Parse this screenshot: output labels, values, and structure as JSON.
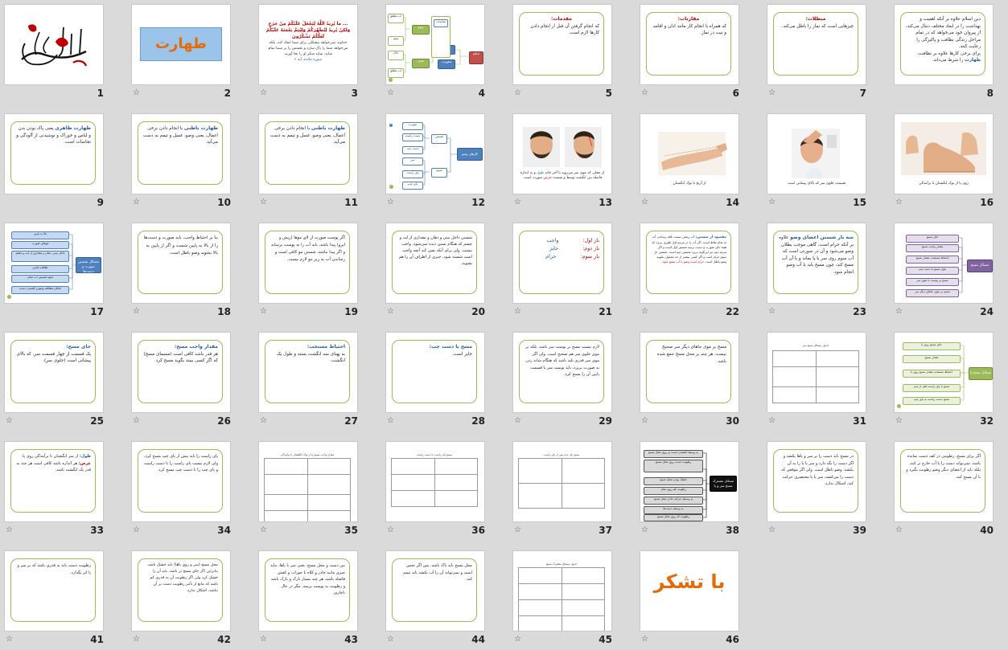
{
  "slides": [
    {
      "num": "1"
    },
    {
      "num": "2",
      "title": "طهارت"
    },
    {
      "num": "3",
      "quote": "... ما یُرِیدُ اللَّهُ لِیَجْعَلَ عَلَیْکُمْ مِنْ حَرَجٍ وَلکِنْ یُرِیدُ لِیُطَهِّرَکُمْ وَلِیُتِمَّ نِعْمَتَهُ عَلَیْکُمْ لَعَلَّکُمْ تَشْکُرُونَ",
      "translation": "خداوند نمی‌خواهد مشکلی برای شما ایجاد کند، بلکه می‌خواهد شما را پاک سازد و نعمتش را بر شما تمام نماید، شاید شکر او را بجا آورید.",
      "source": "سوره مائده، آیه ۶"
    },
    {
      "num": "4",
      "items": [
        "وضو",
        "غسل",
        "تیمم",
        "آب مطلق",
        "خاک",
        "نجاسات",
        "مطهرات",
        "طهارت",
        "احکام"
      ]
    },
    {
      "num": "5",
      "title": "مقدمات:",
      "body": "که انجام گرفتن آن قبل از انجام دادن کارها لازم است."
    },
    {
      "num": "6",
      "title": "مقارنات:",
      "body": "که همراه با انجام کار مانند اذان و اقامه و نیت در نماز."
    },
    {
      "num": "7",
      "title": "مبطلات:",
      "body": "چیزهایی است که نماز را باطل می‌کند."
    },
    {
      "num": "8",
      "body": "دین اسلام علاوه بر آنکه اهمیت و بهداشت را در ابعاد مختلف دنبال می‌کند، از پیروان خود می‌خواهد که در تمام مراحل زندگی نظافت و پاکیزگی را رعایت کنند.",
      "tail_pre": "برای برخی کارها علاوه بر نظافت،",
      "tail_em": "طهارت",
      "tail_post": "را شرط می‌داند."
    },
    {
      "num": "9",
      "title": "طهارت ظاهری",
      "body": "یعنی پاک بودن بدن و لباس و خوراک و نوشیدنی از آلودگی و نجاسات است."
    },
    {
      "num": "10",
      "title": "طهارت باطنی",
      "body": "با انجام دادن برخی اعمال، یعنی وضو، غسل و تیمم به دست می‌آید."
    },
    {
      "num": "11",
      "title": "طهارت باطنی",
      "body": "با انجام دادن برخی اعمال، یعنی وضو، غسل و تیمم به دست می‌آید."
    },
    {
      "num": "12",
      "center": "کارهای وضو",
      "mid": [
        "شستن",
        "مسح"
      ],
      "leaves": [
        "صورت",
        "دست راست",
        "دست چپ",
        "سر",
        "پای راست",
        "پای چپ"
      ]
    },
    {
      "num": "13",
      "caption_pre": "از محلی که موی سر می‌روید تا آخر چانه",
      "caption_h": "طول",
      "caption_mid": "و به اندازه فاصله بین انگشت وسط و شست",
      "caption_r": "عرض",
      "caption_post": "صورت است."
    },
    {
      "num": "14",
      "caption": "از آرنج تا نوک انگشتان"
    },
    {
      "num": "15",
      "caption": "قسمت جلوی سر که بالای پیشانی است"
    },
    {
      "num": "16",
      "caption": "روی پا از نوک انگشتان تا برآمدگی"
    },
    {
      "num": "17",
      "center": "مسائل شستن صورت و دست‌ها",
      "leaves": [
        "بالا به پایین",
        "موهای صورت",
        "داخل بینی، دهان و مقداری از لب و چشم",
        "نظافت لباس",
        "نحوه شستن آب دهان",
        "امکان مطالعه وضو و کشیدن دست"
      ]
    },
    {
      "num": "18",
      "body": "بنا بر احتیاط واجب، باید صورت و دست‌ها را از بالا به پایین شست و اگر از پایین به بالا بشوید وضو باطل است."
    },
    {
      "num": "19",
      "body": "اگر پوست صورت از لای موها (ریش و ابرو) پیدا باشد، باید آب را به پوست برساند و اگر پیدا نباشد، شستن مو کافی است و رساندن آب به زیر مو لازم نیست."
    },
    {
      "num": "20",
      "body": "شستن داخل بینی و دهان و مقداری از لب و چشم که هنگام بستن دیده نمی‌شود، واجب نیست. ولی برای آنکه یقین کند آنچه واجب است شسته شود، چیزی از اطراف آن را هم بشوید."
    },
    {
      "num": "21",
      "rows": [
        {
          "label": "بار اول:",
          "value": "واجب"
        },
        {
          "label": "بار دوم:",
          "value": "جایز"
        },
        {
          "label": "بار سوم:",
          "value": "حرام"
        }
      ]
    },
    {
      "num": "22",
      "title": "مقصود از شستن:",
      "body": "آب ریختن نیست بلکه رساندن آب به تمام نقاط است. اگر آب را در مرتبه اول طوری بریزد که همه جای صورت و دست برسد شستن اول است و اگر مرتبه دوم نیز این‌گونه بریزد شستن دوم است. شستن بار سوم حرام است و اگر کسی بیشتر از حد معمول بشوید وضو باطل است.",
      "tail": "حرام است وضو با آب مسح شود."
    },
    {
      "num": "23",
      "title": "سه بار شستن اعضای وضو",
      "body": "علاوه بر آنکه حرام است، گاهی موجب بطلان وضو می‌شود و آن در صورتی است که آب سوم روی سر یا پا بماند و با آن آب مسح کند، چون مسح باید با آب وضو انجام شود."
    },
    {
      "num": "24",
      "center": "مسائل مسح",
      "leaves": [
        "جای مسح",
        "مقدار واجب مسح",
        "احتیاط مستحب مقدار مسح",
        "جواز مسح با دست چپ",
        "مسح بر پوست یا موی سر",
        "مسح بر موی جاهای دیگر سر"
      ]
    },
    {
      "num": "25",
      "title": "جای مسح:",
      "body": "یک قسمت از چهار قسمت سر، که بالای پیشانی است (جلوی سر)."
    },
    {
      "num": "26",
      "title": "مقدار واجب مسح:",
      "body": "هر قدر باشد کافی است (مسمای مسح) که اگر کسی ببیند بگوید مسح کرد."
    },
    {
      "num": "27",
      "title": "احتیاط مستحب:",
      "body": "به پهنای سه انگشت بسته و طول یک انگشت."
    },
    {
      "num": "28",
      "title": "مسح با دست چپ:",
      "body": "جایز است."
    },
    {
      "num": "29",
      "body": "لازم نیست مسح بر پوست سر باشد، بلکه بر موی جلوی سر هم صحیح است. ولی اگر موی سر قدری بلند باشد که هنگام شانه زدن به صورت بریزد، باید پوست سر یا قسمت پایین آن را مسح کرد."
    },
    {
      "num": "30",
      "body": "مسح بر موی جاهای دیگر سر صحیح نیست، هر چند بر محل مسح جمع شده باشد."
    },
    {
      "num": "31",
      "head": "جدول مسائل مسح سر"
    },
    {
      "num": "32",
      "center": "مسائل مسح پا",
      "leaves": [
        "جای مسح روی پا",
        "مقدار مسح",
        "احتیاط مستحب مقدار مسح روی پا",
        "مسح با پای راست قبل از چپ",
        "مسح دست راست به پای چپ"
      ]
    },
    {
      "num": "33",
      "title_a": "طول:",
      "body_a": "از سر انگشتان تا برآمدگی روی پا.",
      "title_b": "عرض:",
      "body_b": "هر اندازه باشد کافی است هر چند به قدر یک انگشت باشد."
    },
    {
      "num": "34",
      "body": "پای راست را باید پیش از پای چپ مسح کرد، ولی لازم نیست پای راست را با دست راست و پای چپ را با دست چپ مسح کرد."
    },
    {
      "num": "35",
      "head": "مقدار واجب مسح پا از نوک انگشتان تا برآمدگی"
    },
    {
      "num": "36",
      "head": "مسح پای راست با دست راست"
    },
    {
      "num": "37",
      "head": "مسح پای چپ پس از پای راست"
    },
    {
      "num": "38",
      "center": "مسائل مشترک مسح سر و پا",
      "leaves": [
        "به وسیله کشیدن دست بر روی محل مسح",
        "رطوبت دست روی محل مسح",
        "خشک بودن محل مسح",
        "رطوبت کم روی محل",
        "به وسیله حرکت دادن محل مسح",
        "به وسیله دست‌ها",
        "رطوبت که روی محل مسح"
      ]
    },
    {
      "num": "39",
      "body": "در مسح باید دست را بر سر و پاها بکشد و اگر دست را نگه دارد و سر یا پا را به آن بکشد، وضو باطل است. ولی اگر موقعی که دست را می‌کشد، سر یا پا مختصری حرکت کند، اشکال ندارد."
    },
    {
      "num": "40",
      "body": "اگر برای مسح، رطوبتی در کف دست نمانده باشد، نمی‌تواند دست را با آب خارج تر کند، بلکه باید از اعضای دیگر وضو رطوبت بگیرد و با آن مسح کند."
    },
    {
      "num": "41",
      "body": "رطوبت دست باید به قدری باشد که بر سر و پا اثر بگذارد."
    },
    {
      "num": "42",
      "body": "محل مسح (سر و روی پاها) باید خشک باشد. بنابراین اگر جای مسح تر باشد، باید آن را خشک کرد ولی اگر رطوبت آن به قدری کم باشد که مانع از تأثیر رطوبت دست بر آن نباشد، اشکال ندارد."
    },
    {
      "num": "43",
      "body": "بین دست و محل مسح، یعنی سر یا پاها، نباید چیزی مانند چادر و کلاه یا جوراب و کفش فاصله باشد، هر چند بسیار نازک و نازک باشد و رطوبت به پوست برسد، مگر در حال ناچاری."
    },
    {
      "num": "44",
      "body": "محل مسح باید پاک باشد. پس اگر نجس است و نمی‌تواند آن را آب بکشد باید تیمم کند."
    },
    {
      "num": "45",
      "head": "جدول مسائل مشترک مسح"
    },
    {
      "num": "46",
      "title": "با تشکر"
    }
  ]
}
